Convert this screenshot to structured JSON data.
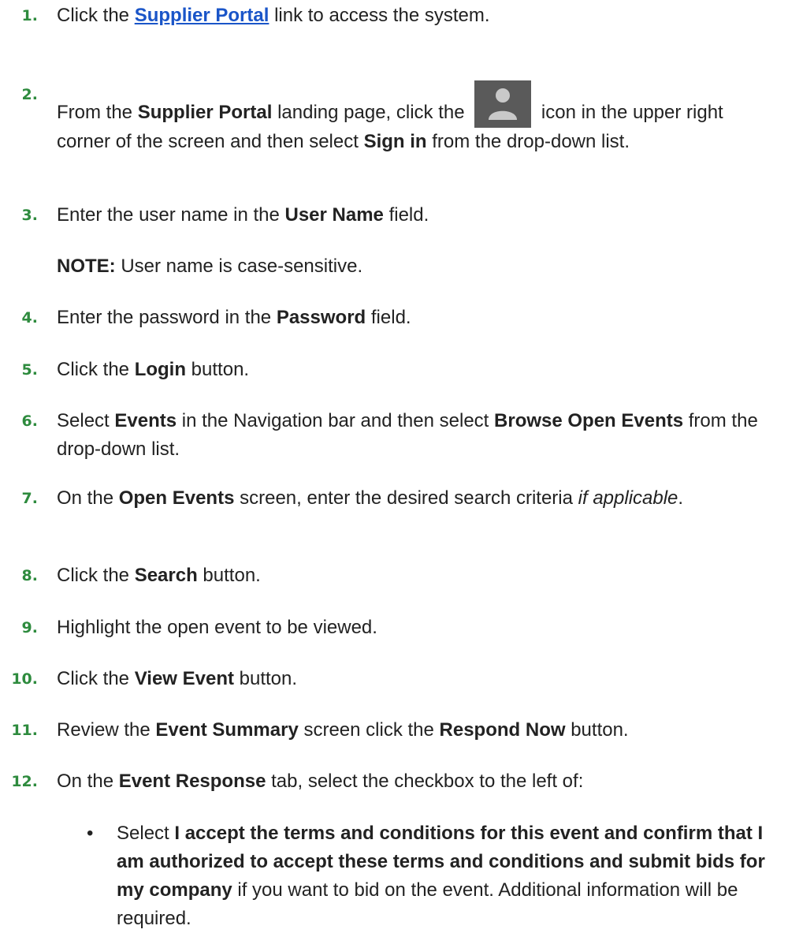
{
  "steps": [
    {
      "num": "1.",
      "before": "Click the ",
      "link": "Supplier Portal",
      "after": " link to access the system."
    },
    {
      "num": "2.",
      "before": "From the ",
      "b1": "Supplier Portal",
      "mid": " landing page, click the ",
      "icon": "user-icon",
      "after": " icon in the upper right corner of the screen and then select ",
      "b2": "Sign in",
      "end": " from the drop-down list."
    },
    {
      "num": "3.",
      "before": "Enter the user name in the ",
      "b1": "User Name",
      "after": " field.",
      "note_label": "NOTE:",
      "note": " User name is case-sensitive."
    },
    {
      "num": "4.",
      "before": "Enter the password in the ",
      "b1": "Password",
      "after": " field."
    },
    {
      "num": "5.",
      "before": "Click the ",
      "b1": "Login",
      "after": " button."
    },
    {
      "num": "6.",
      "before": "Select ",
      "b1": "Events",
      "mid": " in the Navigation bar and then select ",
      "b2": "Browse Open Events",
      "after": " from the drop-down list."
    },
    {
      "num": "7.",
      "before": "On the ",
      "b1": "Open Events",
      "mid": " screen, enter the desired search criteria ",
      "i1": "if applicable",
      "after": "."
    },
    {
      "num": "8.",
      "before": "Click the ",
      "b1": "Search",
      "after": " button."
    },
    {
      "num": "9.",
      "text": "Highlight the open event to be viewed."
    },
    {
      "num": "10.",
      "before": "Click the ",
      "b1": "View Event",
      "after": " button."
    },
    {
      "num": "11.",
      "before": "Review the ",
      "b1": "Event Summary",
      "mid": " screen click the ",
      "b2": "Respond Now",
      "after": " button."
    },
    {
      "num": "12.",
      "before": "On the ",
      "b1": "Event Response",
      "after": " tab, select the checkbox to the left of:"
    }
  ],
  "bullet": {
    "dot": "•",
    "before": "Select ",
    "bold": "I accept the terms and conditions for this event and confirm that I am authorized to accept these terms and conditions and submit bids for my company",
    "after": " if you want to bid on the event. Additional information will be required."
  },
  "colors": {
    "step_number": "#2e8b3e",
    "link": "#1a55c8",
    "icon_bg": "#5a5a5a"
  }
}
